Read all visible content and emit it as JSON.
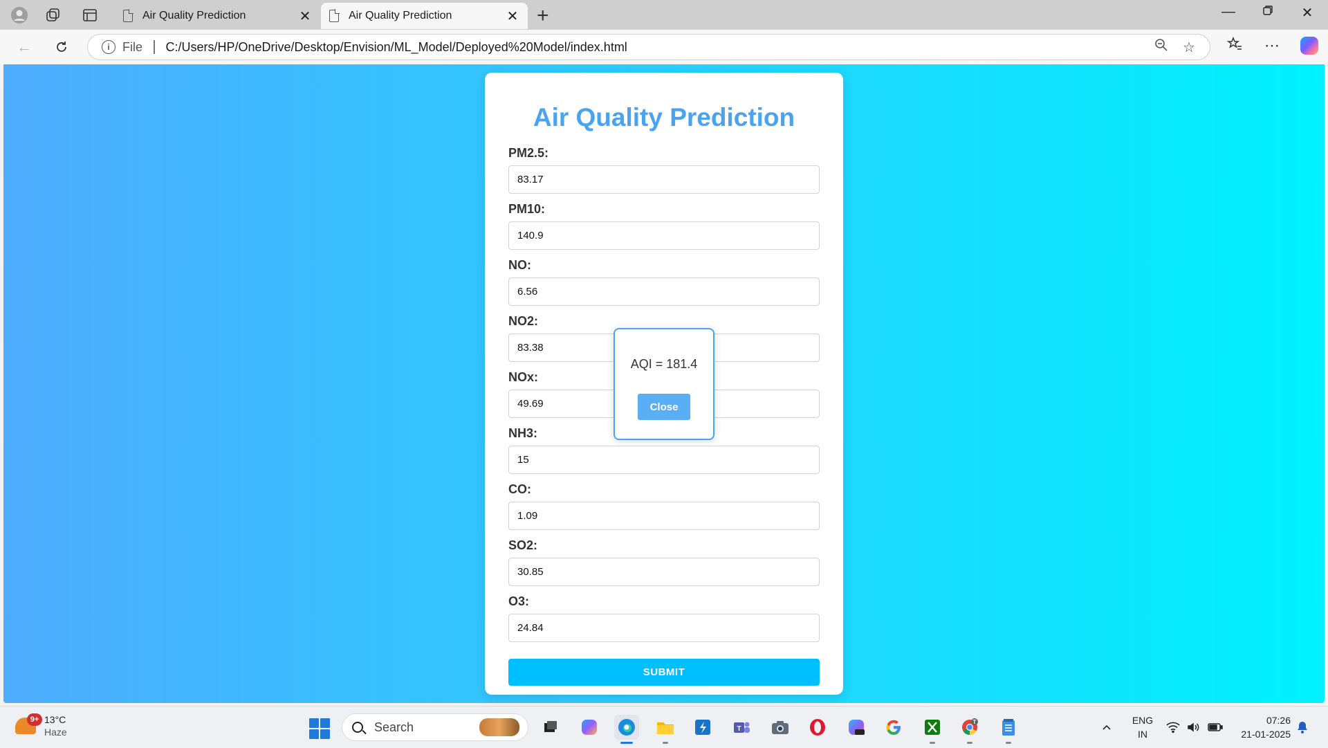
{
  "browser": {
    "tabs": [
      {
        "title": "Air Quality Prediction",
        "active": false
      },
      {
        "title": "Air Quality Prediction",
        "active": true
      }
    ],
    "address": {
      "scheme_label": "File",
      "url": "C:/Users/HP/OneDrive/Desktop/Envision/ML_Model/Deployed%20Model/index.html"
    }
  },
  "page": {
    "title": "Air Quality Prediction",
    "fields": [
      {
        "label": "PM2.5:",
        "value": "83.17"
      },
      {
        "label": "PM10:",
        "value": "140.9"
      },
      {
        "label": "NO:",
        "value": "6.56"
      },
      {
        "label": "NO2:",
        "value": "83.38"
      },
      {
        "label": "NOx:",
        "value": "49.69"
      },
      {
        "label": "NH3:",
        "value": "15"
      },
      {
        "label": "CO:",
        "value": "1.09"
      },
      {
        "label": "SO2:",
        "value": "30.85"
      },
      {
        "label": "O3:",
        "value": "24.84"
      }
    ],
    "submit_label": "SUBMIT",
    "popup": {
      "result_text": "AQI = 181.4",
      "close_label": "Close"
    },
    "colors": {
      "gradient_start": "#4facfe",
      "gradient_end": "#00f2fe",
      "title": "#4aa3f0",
      "submit": "#00bfff"
    }
  },
  "taskbar": {
    "weather": {
      "badge": "9+",
      "temperature": "13°C",
      "condition": "Haze"
    },
    "search_placeholder": "Search",
    "apps": [
      "file-explorer-icon",
      "copilot-icon",
      "edge-icon",
      "folder-icon",
      "sticky-app-icon",
      "teams-icon",
      "camera-icon",
      "opera-icon",
      "m365-icon",
      "google-icon",
      "xbox-icon",
      "chrome-icon",
      "notepad-icon"
    ],
    "tray": {
      "language_line1": "ENG",
      "language_line2": "IN",
      "time": "07:26",
      "date": "21-01-2025"
    }
  }
}
